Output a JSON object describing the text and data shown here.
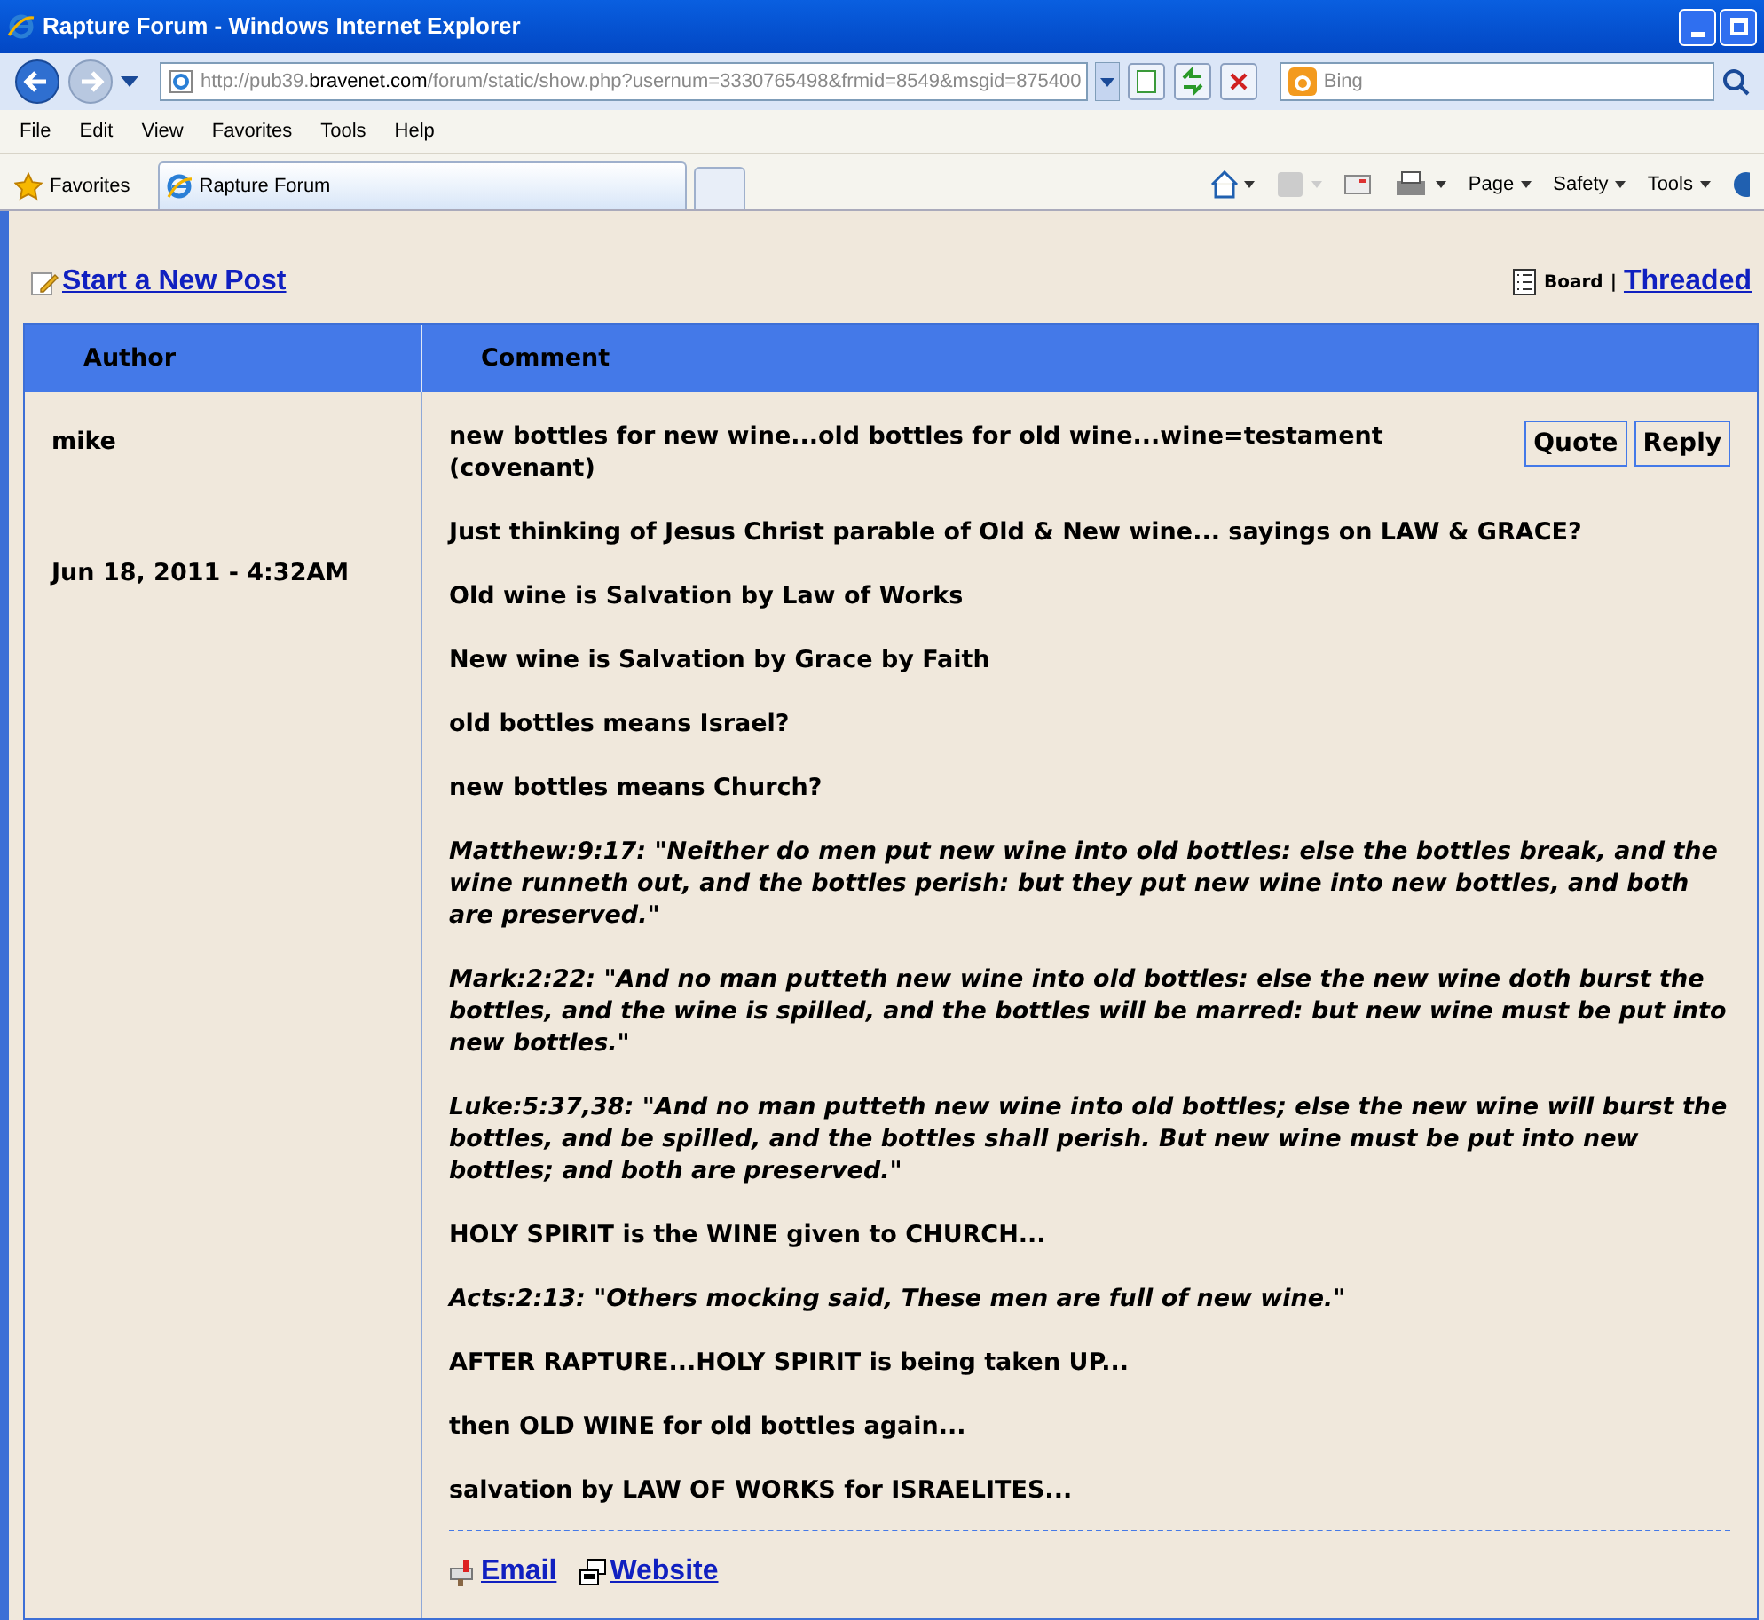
{
  "window": {
    "title": "Rapture Forum - Windows Internet Explorer"
  },
  "address_bar": {
    "prefix": "http://pub39.",
    "domain": "bravenet.com",
    "path": "/forum/static/show.php?usernum=3330765498&frmid=8549&msgid=875400"
  },
  "search": {
    "placeholder": "Bing"
  },
  "menu": [
    "File",
    "Edit",
    "View",
    "Favorites",
    "Tools",
    "Help"
  ],
  "favorites": {
    "label": "Favorites"
  },
  "tabs": [
    {
      "label": "Rapture Forum",
      "selected": true
    }
  ],
  "command_bar": [
    "Page",
    "Safety",
    "Tools"
  ],
  "forum": {
    "new_post": "Start a New Post",
    "view_modes": [
      {
        "label": "Board",
        "selected": true
      },
      {
        "label": "Threaded",
        "selected": false
      }
    ],
    "separator": "|",
    "columns": [
      "Author",
      "Comment"
    ],
    "post": {
      "author": "mike",
      "date": "Jun 18, 2011 - 4:32AM",
      "subject": "new bottles for new wine...old bottles for old wine...wine=testament (covenant)",
      "actions": [
        "Quote",
        "Reply"
      ],
      "paragraphs": [
        {
          "kind": "plain",
          "text": "Just thinking of Jesus Christ parable of Old & New wine... sayings on LAW & GRACE?"
        },
        {
          "kind": "plain",
          "text": "Old wine is Salvation by Law of Works"
        },
        {
          "kind": "plain",
          "text": "New wine is Salvation by Grace by Faith"
        },
        {
          "kind": "plain",
          "text": "old bottles means Israel?"
        },
        {
          "kind": "plain",
          "text": "new bottles means Church?"
        },
        {
          "kind": "quote",
          "text": "Matthew:9:17: \"Neither do men put new wine into old bottles: else the bottles break, and the wine runneth out, and the bottles perish: but they put new wine into new bottles, and both are preserved.\""
        },
        {
          "kind": "quote",
          "text": "Mark:2:22: \"And no man putteth new wine into old bottles: else the new wine doth burst the bottles, and the wine is spilled, and the bottles will be marred: but new wine must be put into new bottles.\""
        },
        {
          "kind": "quote",
          "text": "Luke:5:37,38: \"And no man putteth new wine into old bottles; else the new wine will burst the bottles, and be spilled, and the bottles shall perish. But new wine must be put into new bottles; and both are preserved.\""
        },
        {
          "kind": "plain",
          "text": "HOLY SPIRIT is the WINE given to CHURCH..."
        },
        {
          "kind": "quote",
          "text": "Acts:2:13: \"Others mocking said, These men are full of new wine.\""
        },
        {
          "kind": "plain",
          "text": "AFTER RAPTURE...HOLY SPIRIT is being taken UP..."
        },
        {
          "kind": "plain",
          "text": "then OLD WINE for old bottles again..."
        },
        {
          "kind": "plain",
          "text": "salvation by LAW OF WORKS for ISRAELITES..."
        }
      ],
      "links": [
        {
          "kind": "email",
          "label": "Email"
        },
        {
          "kind": "website",
          "label": "Website"
        }
      ]
    }
  }
}
